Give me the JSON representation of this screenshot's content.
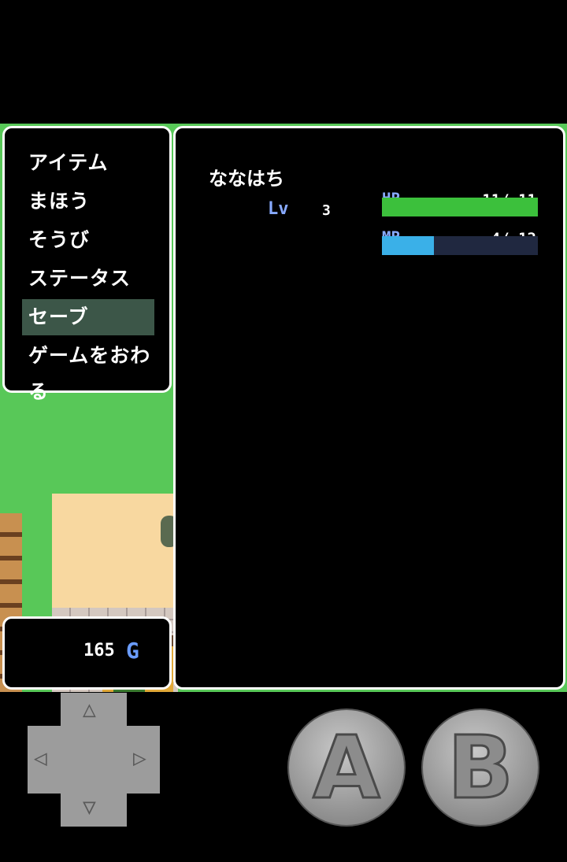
{
  "menu": {
    "items": [
      "アイテム",
      "まほう",
      "そうび",
      "ステータス",
      "セーブ",
      "ゲームをおわる"
    ],
    "selected_index": 4
  },
  "character": {
    "name": "ななはち",
    "level_label": "Lv",
    "level": "3",
    "hp_label": "HP",
    "hp_text": "11/ 11",
    "hp_fraction": 1.0,
    "mp_label": "MP",
    "mp_text": "4/ 12",
    "mp_fraction": 0.333
  },
  "gold": {
    "amount": "165",
    "unit": "G"
  },
  "controls": {
    "a_label": "A",
    "b_label": "B",
    "up_icon": "up-triangle-icon",
    "down_icon": "down-triangle-icon",
    "left_icon": "left-triangle-icon",
    "right_icon": "right-triangle-icon"
  },
  "colors": {
    "hp_fill": "#3cc03c",
    "mp_fill": "#3ab0e8",
    "bar_bg": "#202840",
    "selection": "#3c5648",
    "label_blue": "#88aaff"
  }
}
